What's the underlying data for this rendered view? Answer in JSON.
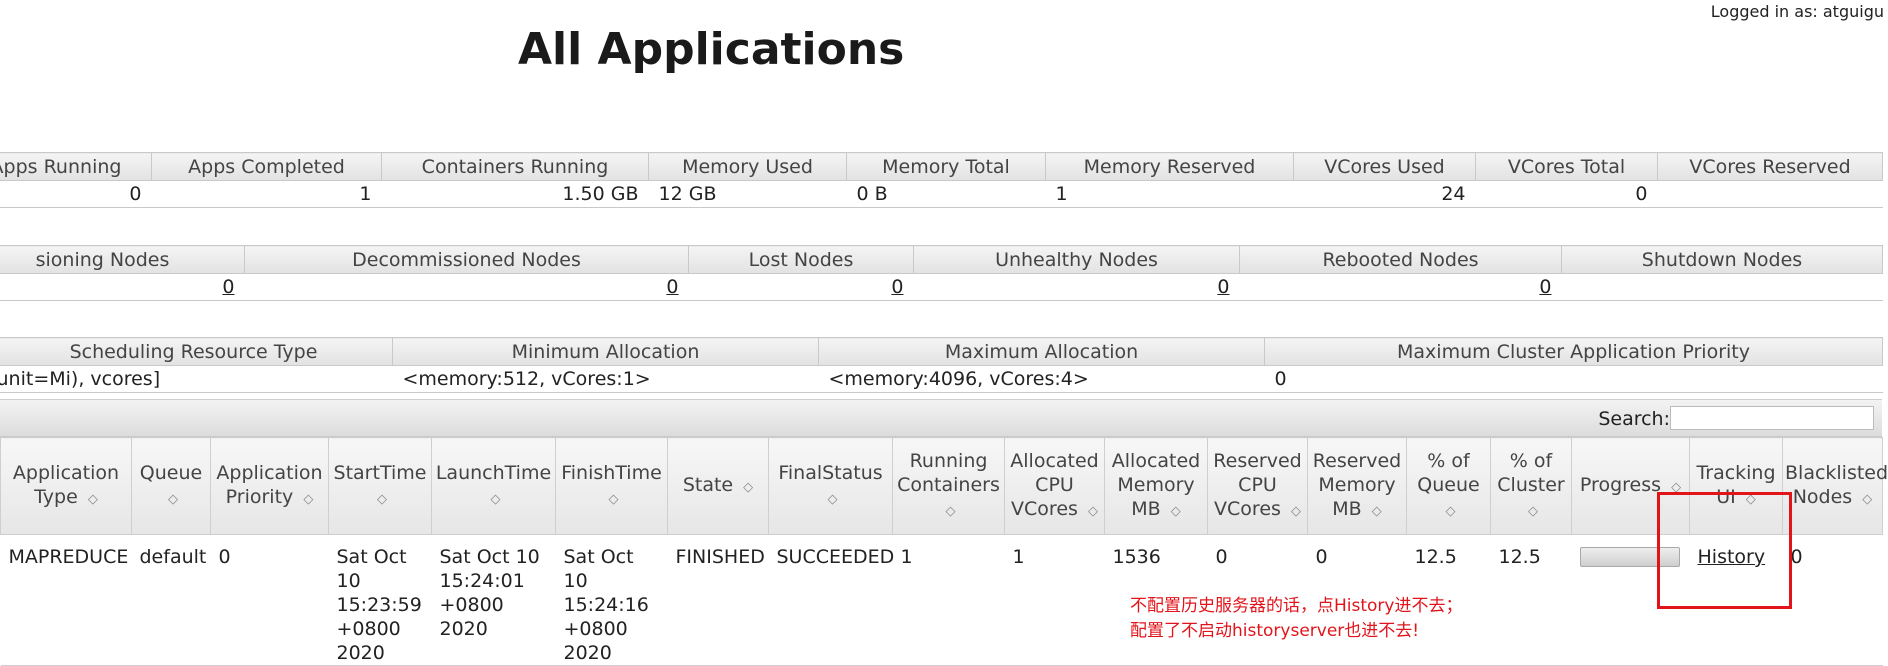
{
  "header": {
    "login_label": "Logged in as: atguigu",
    "title": "All Applications"
  },
  "cluster_metrics": {
    "headers": [
      "Apps Running",
      "Apps Completed",
      "Containers Running",
      "Memory Used",
      "Memory Total",
      "Memory Reserved",
      "VCores Used",
      "VCores Total",
      "VCores Reserved"
    ],
    "values": [
      "0",
      "1",
      "1.50 GB",
      "12 GB",
      "0 B",
      "1",
      "24",
      "0"
    ]
  },
  "node_metrics": {
    "headers": [
      "sioning Nodes",
      "Decommissioned Nodes",
      "Lost Nodes",
      "Unhealthy Nodes",
      "Rebooted Nodes",
      "Shutdown Nodes"
    ],
    "values": [
      "0",
      "0",
      "0",
      "0",
      "0"
    ]
  },
  "scheduler_metrics": {
    "headers": [
      "Scheduling Resource Type",
      "Minimum Allocation",
      "Maximum Allocation",
      "Maximum Cluster Application Priority"
    ],
    "values": [
      "unit=Mi), vcores]",
      "<memory:512, vCores:1>",
      "<memory:4096, vCores:4>",
      "0"
    ]
  },
  "apps_table": {
    "search_label": "Search:",
    "search_value": "",
    "columns": [
      "Application Type",
      "Queue",
      "Application Priority",
      "StartTime",
      "LaunchTime",
      "FinishTime",
      "State",
      "FinalStatus",
      "Running Containers",
      "Allocated CPU VCores",
      "Allocated Memory MB",
      "Reserved CPU VCores",
      "Reserved Memory MB",
      "% of Queue",
      "% of Cluster",
      "Progress",
      "Tracking UI",
      "Blacklisted Nodes"
    ],
    "sort_glyph": "◇",
    "row": {
      "type": "MAPREDUCE",
      "queue": "default",
      "priority": "0",
      "start": "Sat Oct 10 15:23:59 +0800 2020",
      "launch": "Sat Oct 10 15:24:01 +0800 2020",
      "finish": "Sat Oct 10 15:24:16 +0800 2020",
      "state": "FINISHED",
      "final_status": "SUCCEEDED",
      "running_containers": "1",
      "alloc_cpu": "1",
      "alloc_mem": "1536",
      "res_cpu": "0",
      "res_mem": "0",
      "pct_queue": "12.5",
      "pct_cluster": "12.5",
      "progress": 1.0,
      "tracking_ui": "History",
      "blacklisted": "0"
    }
  },
  "annotation": {
    "line1": "不配置历史服务器的话，点History进不去；",
    "line2": "配置了不启动historyserver也进不去!",
    "color": "#e2141a"
  }
}
